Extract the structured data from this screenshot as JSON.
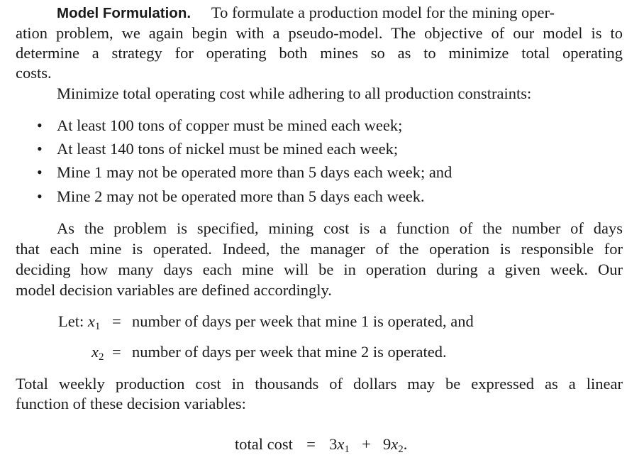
{
  "paragraph1": {
    "heading": "Model Formulation.",
    "line1_rest": "To formulate a production model for the mining oper-",
    "line2": "ation problem, we again begin with a pseudo-model. The objective of our model is to",
    "line3": "determine a strategy for operating both mines so as to minimize total operating",
    "line4": "costs."
  },
  "pseudo_objective": "Minimize total operating cost while adhering to all production constraints:",
  "bullets": [
    "At least 100 tons of copper must be mined each week;",
    "At least 140 tons of nickel must be mined each week;",
    "Mine 1 may not be operated more than 5 days each week; and",
    "Mine 2 may not be operated more than 5 days each week."
  ],
  "bullet_symbol": "•",
  "paragraph2": {
    "line1": "As the problem is specified, mining cost is a function of the number of days",
    "line2": "that each mine is operated. Indeed, the manager of the operation is responsible for",
    "line3": "deciding how many days each mine will be in operation during a given week. Our",
    "line4": "model decision variables are defined accordingly."
  },
  "definitions": {
    "let_label": "Let:",
    "var": "x",
    "sub1": "1",
    "sub2": "2",
    "equals": "=",
    "def1": "number of days per week that mine 1 is operated, and",
    "def2": "number of days per week that mine 2 is operated."
  },
  "paragraph3": {
    "line1": "Total weekly production cost in thousands of dollars may be expressed as a linear",
    "line2": "function of these decision variables:"
  },
  "cost_equation": {
    "lhs": "total cost",
    "equals": "=",
    "coef1": "3",
    "var1": "x",
    "sub1": "1",
    "plus": "+",
    "coef2": "9",
    "var2": "x",
    "sub2": "2",
    "end": "."
  }
}
